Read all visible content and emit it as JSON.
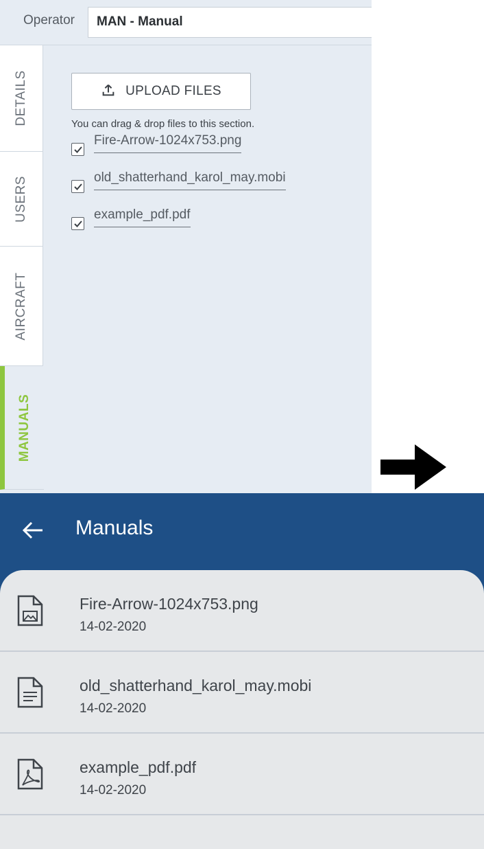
{
  "operator": {
    "label": "Operator",
    "value": "MAN - Manual"
  },
  "tabs": [
    {
      "label": "DETAILS",
      "active": false
    },
    {
      "label": "USERS",
      "active": false
    },
    {
      "label": "AIRCRAFT",
      "active": false
    },
    {
      "label": "MANUALS",
      "active": true
    }
  ],
  "upload": {
    "button_label": "UPLOAD FILES",
    "hint": "You can drag & drop files to this section."
  },
  "files": [
    {
      "name": "Fire-Arrow-1024x753.png",
      "checked": true
    },
    {
      "name": "old_shatterhand_karol_may.mobi",
      "checked": true
    },
    {
      "name": "example_pdf.pdf",
      "checked": true
    }
  ],
  "transition_icon": "right-arrow-icon",
  "mobile": {
    "title": "Manuals",
    "back_icon": "back-arrow-icon",
    "items": [
      {
        "name": "Fire-Arrow-1024x753.png",
        "date": "14-02-2020",
        "icon": "image-file-icon"
      },
      {
        "name": "old_shatterhand_karol_may.mobi",
        "date": "14-02-2020",
        "icon": "text-file-icon"
      },
      {
        "name": "example_pdf.pdf",
        "date": "14-02-2020",
        "icon": "pdf-file-icon"
      }
    ]
  },
  "colors": {
    "accent_green": "#8ec63f",
    "header_blue": "#1e4f86",
    "panel_bg": "#e6ecf3"
  }
}
